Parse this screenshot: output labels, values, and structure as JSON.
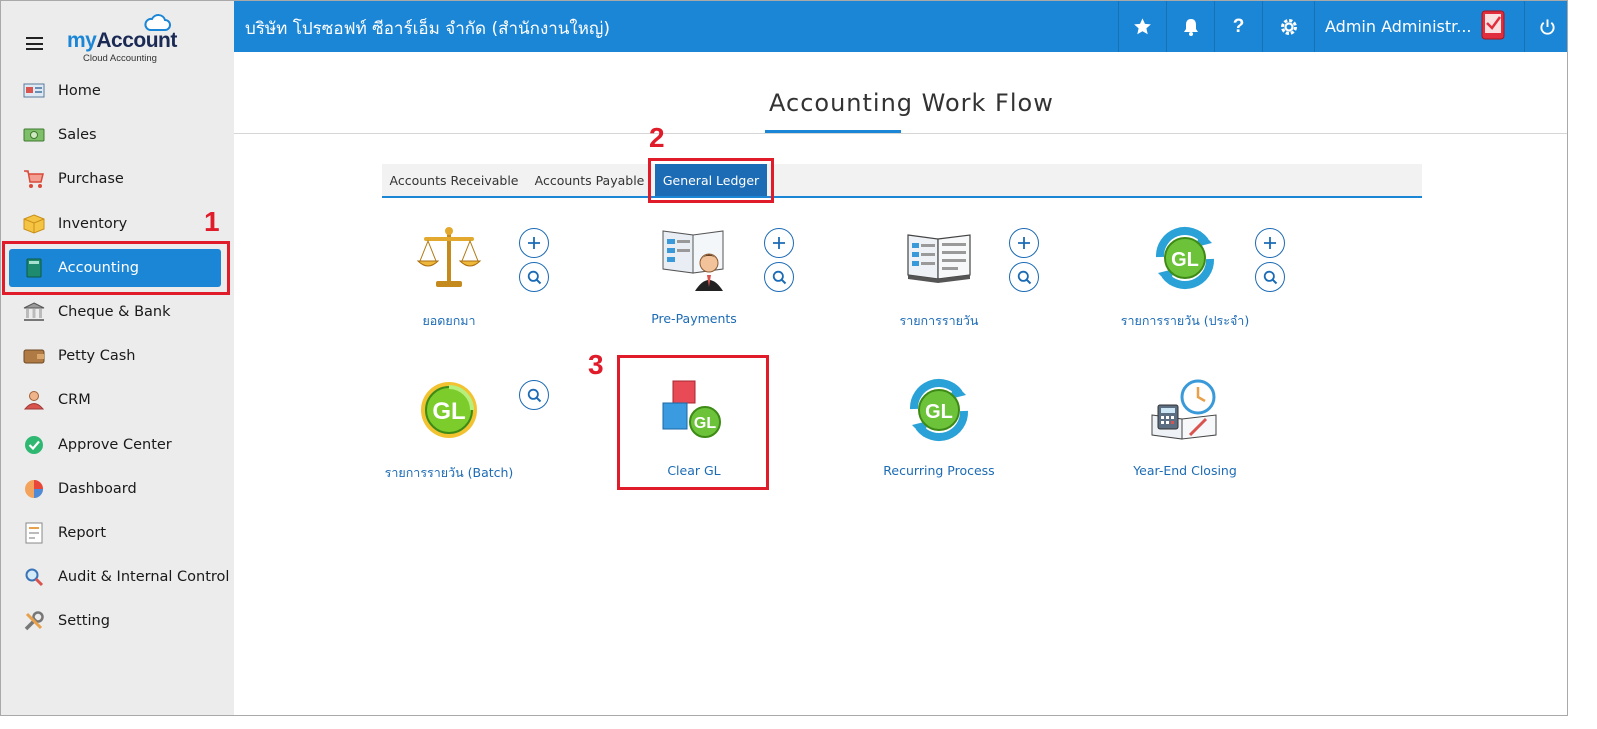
{
  "logo": {
    "my": "my",
    "account": "Account",
    "subtitle": "Cloud Accounting"
  },
  "header": {
    "company": "บริษัท โปรซอฟท์ ซีอาร์เอ็ม จำกัด (สำนักงานใหญ่)",
    "user_name": "Admin Administr...",
    "icons": [
      "star-icon",
      "bell-icon",
      "help-icon",
      "gear-icon",
      "avatar-icon",
      "power-icon"
    ]
  },
  "sidebar": {
    "items": [
      {
        "label": "Home",
        "icon": "home-icon",
        "active": false
      },
      {
        "label": "Sales",
        "icon": "money-icon",
        "active": false
      },
      {
        "label": "Purchase",
        "icon": "cart-icon",
        "active": false
      },
      {
        "label": "Inventory",
        "icon": "box-icon",
        "active": false
      },
      {
        "label": "Accounting",
        "icon": "book-icon",
        "active": true
      },
      {
        "label": "Cheque & Bank",
        "icon": "bank-icon",
        "active": false
      },
      {
        "label": "Petty Cash",
        "icon": "wallet-icon",
        "active": false
      },
      {
        "label": "CRM",
        "icon": "person-icon",
        "active": false
      },
      {
        "label": "Approve Center",
        "icon": "check-icon",
        "active": false
      },
      {
        "label": "Dashboard",
        "icon": "pie-icon",
        "active": false
      },
      {
        "label": "Report",
        "icon": "report-icon",
        "active": false
      },
      {
        "label": "Audit & Internal Control",
        "icon": "magnifier-icon",
        "active": false
      },
      {
        "label": "Setting",
        "icon": "tools-icon",
        "active": false
      }
    ]
  },
  "main": {
    "title": "Accounting Work Flow",
    "tabs": [
      {
        "label": "Accounts Receivable",
        "active": false
      },
      {
        "label": "Accounts Payable",
        "active": false
      },
      {
        "label": "General Ledger",
        "active": true
      }
    ],
    "tiles": [
      {
        "label": "ยอดยกมา",
        "icon": "scales-icon",
        "add": true,
        "search": true
      },
      {
        "label": "Pre-Payments",
        "icon": "prepayment-icon",
        "add": true,
        "search": true
      },
      {
        "label": "รายการรายวัน",
        "icon": "journal-icon",
        "add": true,
        "search": true
      },
      {
        "label": "รายการรายวัน (ประจำ)",
        "icon": "gl-recurring-icon",
        "add": true,
        "search": true
      },
      {
        "label": "รายการรายวัน (Batch)",
        "icon": "gl-batch-icon",
        "add": false,
        "search": true
      },
      {
        "label": "Clear GL",
        "icon": "clear-gl-icon",
        "add": false,
        "search": false
      },
      {
        "label": "Recurring Process",
        "icon": "gl-process-icon",
        "add": false,
        "search": false
      },
      {
        "label": "Year-End Closing",
        "icon": "year-end-icon",
        "add": false,
        "search": false
      }
    ]
  },
  "annotations": {
    "step1": "1",
    "step2": "2",
    "step3": "3"
  },
  "colors": {
    "primary": "#1c86d6",
    "tab_active": "#1c6bb5",
    "highlight": "#e01b2a",
    "sidebar_bg": "#ececec"
  }
}
